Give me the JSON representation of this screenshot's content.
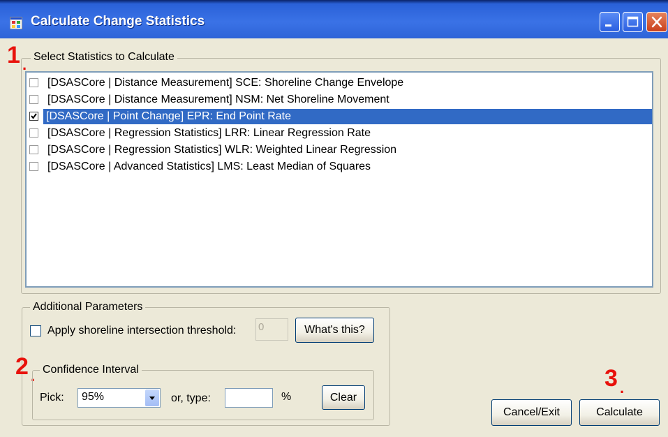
{
  "window": {
    "title": "Calculate Change Statistics"
  },
  "steps": {
    "step1": "1",
    "step2": "2",
    "step3": "3"
  },
  "statistics": {
    "group_label": "Select Statistics to Calculate",
    "items": [
      {
        "label": "[DSASCore | Distance Measurement] SCE: Shoreline Change Envelope",
        "checked": false,
        "selected": false
      },
      {
        "label": "[DSASCore | Distance Measurement] NSM: Net Shoreline Movement",
        "checked": false,
        "selected": false
      },
      {
        "label": "[DSASCore | Point Change] EPR: End Point Rate",
        "checked": true,
        "selected": true
      },
      {
        "label": "[DSASCore | Regression Statistics] LRR: Linear Regression Rate",
        "checked": false,
        "selected": false
      },
      {
        "label": "[DSASCore | Regression Statistics] WLR: Weighted Linear Regression",
        "checked": false,
        "selected": false
      },
      {
        "label": "[DSASCore | Advanced Statistics] LMS: Least Median of Squares",
        "checked": false,
        "selected": false
      }
    ]
  },
  "additional": {
    "group_label": "Additional Parameters",
    "threshold_label": "Apply shoreline intersection threshold:",
    "threshold_checked": false,
    "threshold_value": "0",
    "whats_this_label": "What's this?"
  },
  "confidence": {
    "group_label": "Confidence Interval",
    "pick_label": "Pick:",
    "pick_value": "95%",
    "type_label": "or, type:",
    "type_value": "",
    "percent_label": "%",
    "clear_label": "Clear"
  },
  "buttons": {
    "cancel_label": "Cancel/Exit",
    "calculate_label": "Calculate"
  },
  "colors": {
    "titlebar": "#2d63d7",
    "selection": "#316ac5",
    "step_annotation": "#e8120c",
    "dialog_bg": "#ece9d8"
  }
}
